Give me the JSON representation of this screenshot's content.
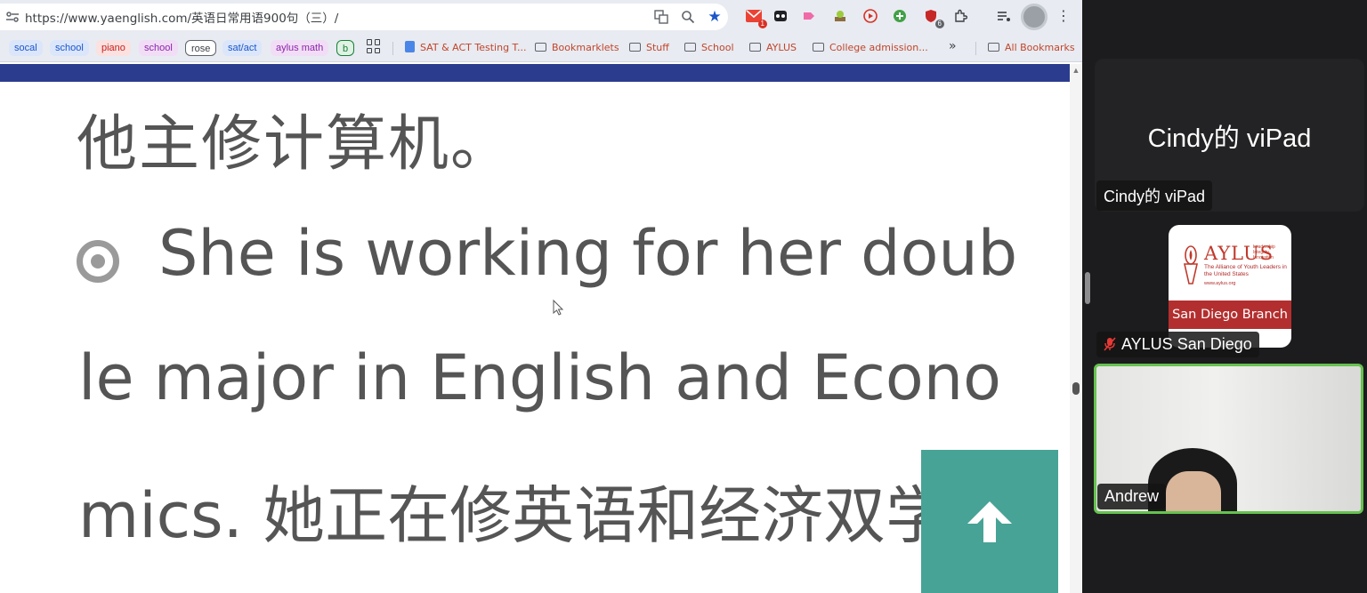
{
  "browser": {
    "url": "https://www.yaenglish.com/英语日常用语900句（三）/",
    "extension_badges": {
      "gmail": "1",
      "shield": "6"
    },
    "bookmark_groups": [
      {
        "label": "socal",
        "color": "#1a56c9",
        "bg": "#dbe6fb"
      },
      {
        "label": "school",
        "color": "#1a56c9",
        "bg": "#dbe6fb"
      },
      {
        "label": "piano",
        "color": "#c5221f",
        "bg": "#fbe1df"
      },
      {
        "label": "school",
        "color": "#8e24aa",
        "bg": "#f1def6"
      },
      {
        "label": "rose",
        "color": "#3c4043",
        "bg": "#ffffff"
      },
      {
        "label": "sat/act",
        "color": "#1a56c9",
        "bg": "#dbe6fb"
      },
      {
        "label": "aylus math",
        "color": "#8e24aa",
        "bg": "#f1def6"
      },
      {
        "label": "b",
        "color": "#188038",
        "bg": "#e0f2e4"
      }
    ],
    "bookmarks": [
      {
        "label": "SAT & ACT Testing T...",
        "icon": "doc-icon"
      },
      {
        "label": "Bookmarklets",
        "icon": "folder-icon"
      },
      {
        "label": "Stuff",
        "icon": "folder-icon"
      },
      {
        "label": "School",
        "icon": "folder-icon"
      },
      {
        "label": "AYLUS",
        "icon": "folder-icon"
      },
      {
        "label": "College admission...",
        "icon": "folder-icon"
      }
    ],
    "overflow": "»",
    "all_bookmarks": "All Bookmarks"
  },
  "page": {
    "chinese_heading": "他主修计算机。",
    "english_line1": "She is working for her doub",
    "english_line2": "le major in English and Econo",
    "english_line3": "mics. 她正在修英语和经济双学",
    "accent": "#2b3c8f",
    "back_to_top_color": "#47a395"
  },
  "zoom": {
    "tile1_name": "Cindy的 viPad",
    "tile1_tag": "Cindy的 viPad",
    "aylus": {
      "title": "AYLUS",
      "tagline": [
        "Leadership",
        "Integrity",
        "Innovation"
      ],
      "subtitle": "The Alliance of Youth Leaders in the United States",
      "website": "www.aylus.org",
      "branch": "San Diego Branch"
    },
    "tile2_tag": "AYLUS San Diego",
    "tile3_tag": "Andrew",
    "active_speaker_color": "#66c24f"
  }
}
